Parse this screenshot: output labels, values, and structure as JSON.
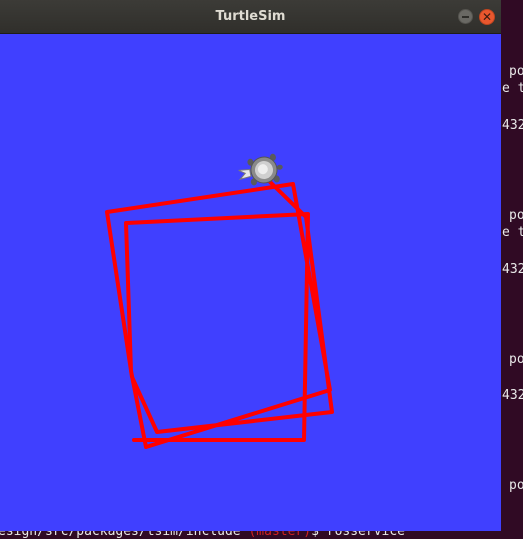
{
  "window": {
    "title": "TurtleSim",
    "close_glyph": "✕",
    "background_color": "#4040ff",
    "pen_color": "#ff0000"
  },
  "terminal": {
    "right_lines": [
      "po",
      "e t",
      "432",
      "po",
      "e t",
      "432",
      "po",
      "432",
      "po"
    ],
    "prompt": {
      "path": "esign/src/packages/tsim/include",
      "branch": "(master)",
      "tail": "$ rosservice"
    }
  },
  "icons": {
    "turtle": "turtle-icon",
    "minimize": "minimize-icon",
    "close": "close-icon"
  }
}
